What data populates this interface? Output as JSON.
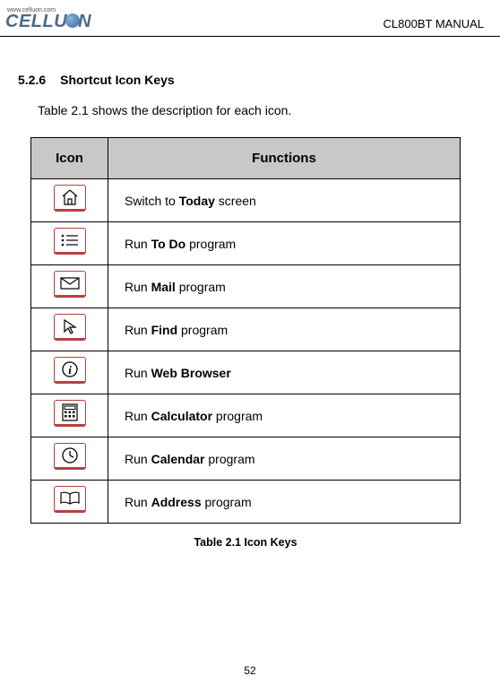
{
  "header": {
    "logo_url": "www.celluon.com",
    "logo_text_pre": "CELLU",
    "logo_text_post": "N",
    "doc_title": "CL800BT MANUAL"
  },
  "section": {
    "number": "5.2.6",
    "title": "Shortcut Icon Keys",
    "intro": "Table 2.1 shows the description for each icon."
  },
  "table": {
    "header_icon": "Icon",
    "header_func": "Functions",
    "rows": [
      {
        "icon": "home-icon",
        "pre": "Switch to ",
        "bold": "Today",
        "post": " screen"
      },
      {
        "icon": "list-icon",
        "pre": "Run ",
        "bold": "To Do",
        "post": " program"
      },
      {
        "icon": "mail-icon",
        "pre": "Run ",
        "bold": "Mail",
        "post": " program"
      },
      {
        "icon": "cursor-icon",
        "pre": "Run ",
        "bold": "Find",
        "post": " program"
      },
      {
        "icon": "info-icon",
        "pre": "Run ",
        "bold": "Web Browser",
        "post": ""
      },
      {
        "icon": "calculator-icon",
        "pre": "Run ",
        "bold": "Calculator",
        "post": " program"
      },
      {
        "icon": "clock-icon",
        "pre": "Run ",
        "bold": "Calendar",
        "post": " program"
      },
      {
        "icon": "book-icon",
        "pre": "Run ",
        "bold": "Address",
        "post": " program"
      }
    ],
    "caption": "Table 2.1 Icon Keys"
  },
  "page_number": "52"
}
